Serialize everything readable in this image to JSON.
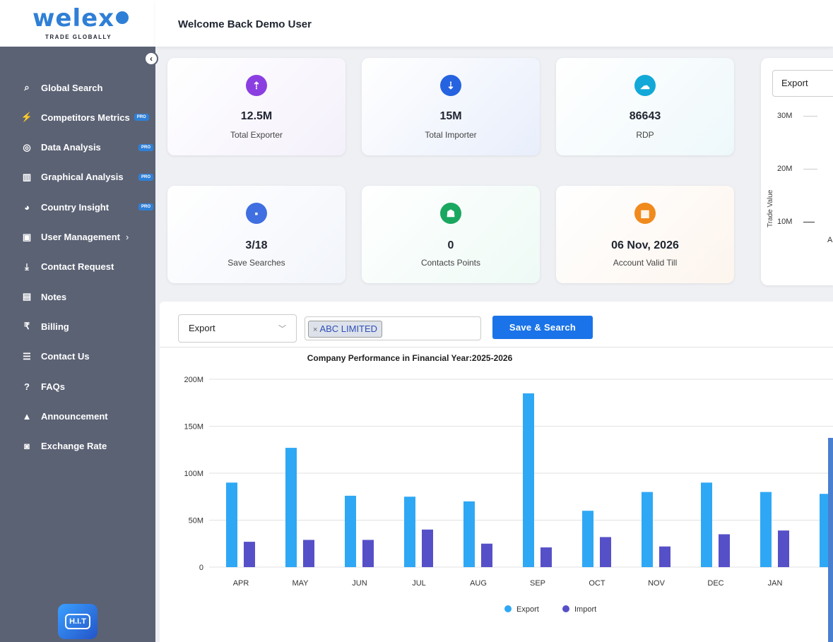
{
  "brand": {
    "name": "welex",
    "tagline": "TRADE GLOBALLY"
  },
  "header": {
    "welcome": "Welcome Back Demo User"
  },
  "sidebar": {
    "items": [
      {
        "label": "Global Search",
        "icon": "search-icon",
        "pro": false
      },
      {
        "label": "Competitors Metrics",
        "icon": "bolt-icon",
        "pro": true
      },
      {
        "label": "Data Analysis",
        "icon": "analysis-icon",
        "pro": true
      },
      {
        "label": "Graphical Analysis",
        "icon": "bar-chart-icon",
        "pro": true
      },
      {
        "label": "Country Insight",
        "icon": "globe-icon",
        "pro": true
      },
      {
        "label": "User Management",
        "icon": "user-card-icon",
        "pro": false,
        "submenu": true
      },
      {
        "label": "Contact Request",
        "icon": "download-tray-icon",
        "pro": false
      },
      {
        "label": "Notes",
        "icon": "calendar-icon",
        "pro": false
      },
      {
        "label": "Billing",
        "icon": "rupee-icon",
        "pro": false
      },
      {
        "label": "Contact Us",
        "icon": "list-icon",
        "pro": false
      },
      {
        "label": "FAQs",
        "icon": "question-icon",
        "pro": false
      },
      {
        "label": "Announcement",
        "icon": "megaphone-icon",
        "pro": false
      },
      {
        "label": "Exchange Rate",
        "icon": "camera-icon",
        "pro": false
      }
    ],
    "pro_label": "PRO",
    "help_badge": "H.I.T"
  },
  "cards": [
    {
      "value": "12.5M",
      "label": "Total Exporter",
      "icon": "sort-up-icon",
      "color": "#8b3fe0",
      "bg": "#f4f0fb"
    },
    {
      "value": "15M",
      "label": "Total Importer",
      "icon": "sort-down-icon",
      "color": "#2563e0",
      "bg": "#e8eefb"
    },
    {
      "value": "86643",
      "label": "RDP",
      "icon": "cloud-upload-icon",
      "color": "#12a8d8",
      "bg": "#eef8fb"
    },
    {
      "value": "3/18",
      "label": "Save Searches",
      "icon": "floppy-icon",
      "color": "#3f6fe0",
      "bg": "#f2f5fb"
    },
    {
      "value": "0",
      "label": "Contacts Points",
      "icon": "contact-book-icon",
      "color": "#1aa760",
      "bg": "#eefaf5"
    },
    {
      "value": "06 Nov, 2026",
      "label": "Account Valid Till",
      "icon": "calendar-icon",
      "color": "#f08a1c",
      "bg": "#fdf5ee"
    }
  ],
  "mini_chart": {
    "select_value": "Export",
    "ylabel": "Trade Value",
    "ticks": [
      "30M",
      "20M",
      "10M"
    ],
    "x_first_partial": "Ap"
  },
  "performance": {
    "trade_type": "Export",
    "company_tag": "ABC LIMITED",
    "save_button": "Save & Search"
  },
  "chart_data": {
    "type": "bar",
    "title": "Company Performance in Financial Year:2025-2026",
    "categories": [
      "APR",
      "MAY",
      "JUN",
      "JUL",
      "AUG",
      "SEP",
      "OCT",
      "NOV",
      "DEC",
      "JAN"
    ],
    "series": [
      {
        "name": "Export",
        "color": "#2ea8f5",
        "values": [
          90,
          127,
          76,
          75,
          70,
          185,
          60,
          80,
          90,
          80
        ]
      },
      {
        "name": "Import",
        "color": "#5650c8",
        "values": [
          27,
          29,
          29,
          40,
          25,
          21,
          32,
          22,
          35,
          39
        ]
      }
    ],
    "extra_partial_export_value": 78,
    "ylim": [
      0,
      200
    ],
    "yticks": [
      "0",
      "50M",
      "100M",
      "150M",
      "200M"
    ],
    "grid": true,
    "legend": "bottom-center"
  }
}
